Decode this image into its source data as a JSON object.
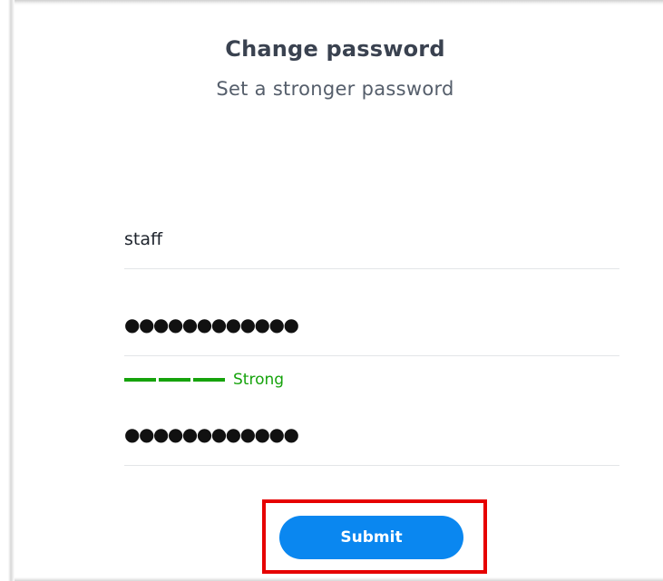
{
  "dialog": {
    "title": "Change password",
    "subtitle": "Set a stronger password"
  },
  "form": {
    "username": "staff",
    "new_password_masked": "●●●●●●●●●●●●",
    "strength": {
      "label": "Strong",
      "filled_segments": 3,
      "total_segments": 3,
      "color": "#16a30c"
    },
    "confirm_password_masked": "●●●●●●●●●●●●"
  },
  "actions": {
    "submit_label": "Submit",
    "submit_color": "#0a87f0",
    "highlight_color": "#e60000"
  }
}
